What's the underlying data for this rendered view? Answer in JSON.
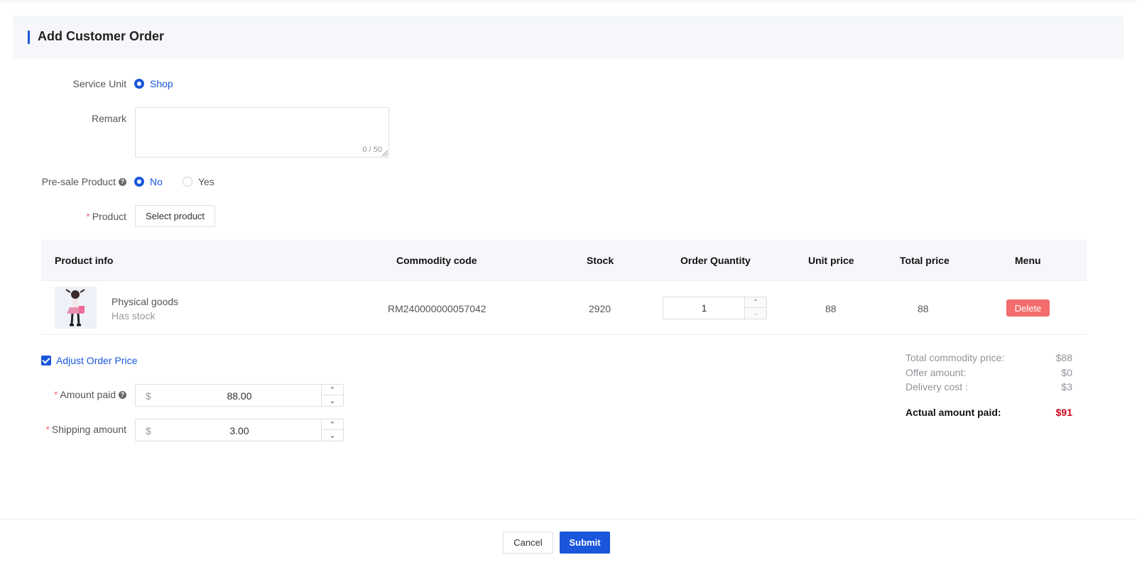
{
  "header": {
    "title": "Add Customer Order"
  },
  "form": {
    "service_unit": {
      "label": "Service Unit",
      "options": [
        "Shop"
      ],
      "selected": "Shop"
    },
    "remark": {
      "label": "Remark",
      "value": "",
      "counter": "0 / 50"
    },
    "presale": {
      "label": "Pre-sale Product",
      "options": [
        "No",
        "Yes"
      ],
      "selected": "No"
    },
    "product": {
      "label": "Product",
      "select_button": "Select product"
    }
  },
  "table": {
    "columns": [
      "Product info",
      "Commodity code",
      "Stock",
      "Order Quantity",
      "Unit price",
      "Total price",
      "Menu"
    ],
    "rows": [
      {
        "name": "Physical goods",
        "stock_status": "Has stock",
        "code": "RM240000000057042",
        "stock": "2920",
        "quantity": "1",
        "unit_price": "88",
        "total_price": "88",
        "action": "Delete"
      }
    ]
  },
  "adjust": {
    "checkbox_label": "Adjust Order Price",
    "checked": true,
    "amount_paid": {
      "label": "Amount paid",
      "prefix": "$",
      "value": "88.00"
    },
    "shipping": {
      "label": "Shipping amount",
      "prefix": "$",
      "value": "3.00"
    }
  },
  "summary": {
    "total_commodity": {
      "label": "Total commodity price:",
      "value": "$88"
    },
    "offer": {
      "label": "Offer amount:",
      "value": "$0"
    },
    "delivery": {
      "label": "Delivery cost :",
      "value": "$3"
    },
    "actual": {
      "label": "Actual amount paid:",
      "value": "$91"
    }
  },
  "footer": {
    "cancel": "Cancel",
    "submit": "Submit"
  },
  "colors": {
    "primary": "#1a56db",
    "danger": "#f56c6c",
    "actual_amount": "#d0021b"
  }
}
